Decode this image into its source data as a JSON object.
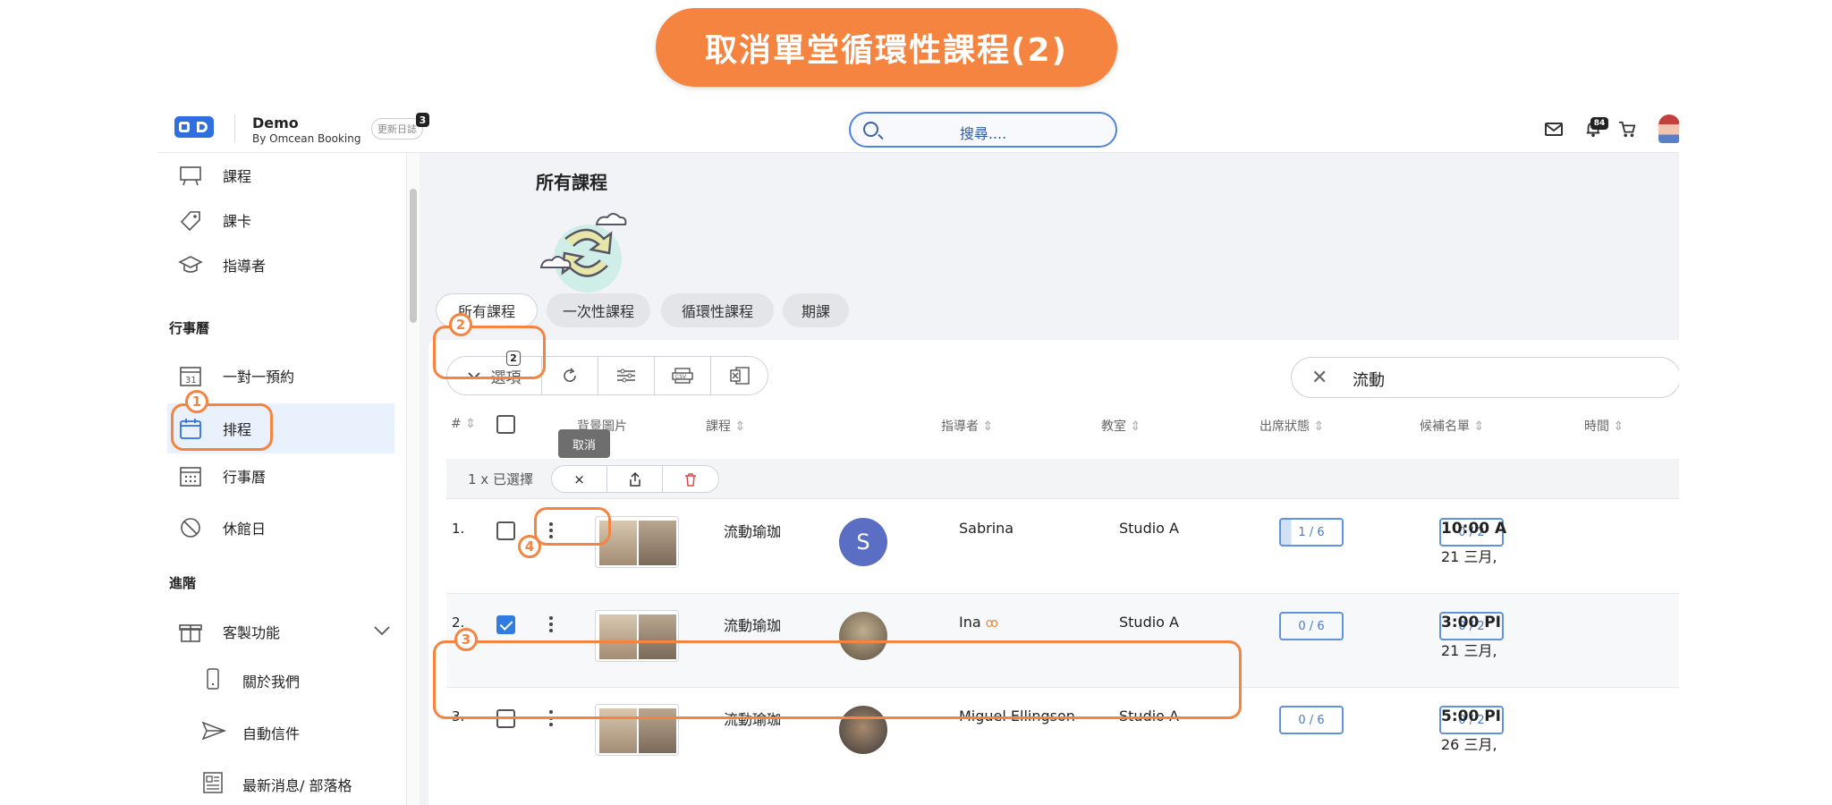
{
  "banner": {
    "title": "取消單堂循環性課程(2)"
  },
  "header": {
    "brand_name": "Demo",
    "brand_sub": "By Omcean Booking",
    "changelog_label": "更新日誌",
    "changelog_badge": "3",
    "search_placeholder": "搜尋....",
    "notification_count": "84"
  },
  "sidebar": {
    "items": [
      {
        "label": "課程",
        "icon": "presentation-board-icon"
      },
      {
        "label": "課卡",
        "icon": "tag-icon"
      },
      {
        "label": "指導者",
        "icon": "graduation-cap-icon"
      }
    ],
    "section_calendar": "行事曆",
    "calendar_items": [
      {
        "label": "一對一預約",
        "icon": "calendar-31-icon"
      },
      {
        "label": "排程",
        "icon": "calendar-icon",
        "active": true
      },
      {
        "label": "行事曆",
        "icon": "calendar-grid-icon"
      },
      {
        "label": "休館日",
        "icon": "prohibited-icon"
      }
    ],
    "section_advanced": "進階",
    "advanced_items": [
      {
        "label": "客製功能",
        "icon": "gift-icon"
      }
    ],
    "sub_items": [
      {
        "label": "關於我們",
        "icon": "phone-icon"
      },
      {
        "label": "自動信件",
        "icon": "send-icon"
      },
      {
        "label": "最新消息/ 部落格",
        "icon": "news-icon"
      }
    ]
  },
  "main": {
    "page_title": "所有課程",
    "tabs": [
      "所有課程",
      "一次性課程",
      "循環性課程",
      "期課"
    ],
    "toolbar": {
      "options_label": "選項",
      "options_badge": "2"
    },
    "filter_value": "流動",
    "columns": [
      "#",
      "背景圖片",
      "課程",
      "指導者",
      "教室",
      "出席狀態",
      "候補名單",
      "時間"
    ],
    "selection": {
      "text": "1 x 已選擇",
      "tooltip": "取消",
      "cancel_symbol": "×"
    },
    "rows": [
      {
        "num": "1.",
        "course": "流動瑜珈",
        "instructor": "Sabrina",
        "avatar_letter": "S",
        "room": "Studio A",
        "attendance": "1 / 6",
        "waitlist": "0 / 2",
        "time": "10:00 A",
        "date": "21 三月,",
        "checked": false
      },
      {
        "num": "2.",
        "course": "流動瑜珈",
        "instructor": "Ina",
        "room": "Studio A",
        "attendance": "0 / 6",
        "waitlist": "0 / 2",
        "time": "3:00 PI",
        "date": "21 三月,",
        "checked": true
      },
      {
        "num": "3.",
        "course": "流動瑜珈",
        "instructor": "Miguel Ellingson",
        "room": "Studio A",
        "attendance": "0 / 6",
        "waitlist": "0 / 2",
        "time": "5:00 PI",
        "date": "26 三月,",
        "checked": false
      }
    ]
  },
  "annotations": {
    "steps": [
      "1",
      "2",
      "3",
      "4"
    ]
  },
  "colors": {
    "accent": "#f4843f",
    "primary": "#2f7de1",
    "active_bg": "#e9f1fd"
  }
}
